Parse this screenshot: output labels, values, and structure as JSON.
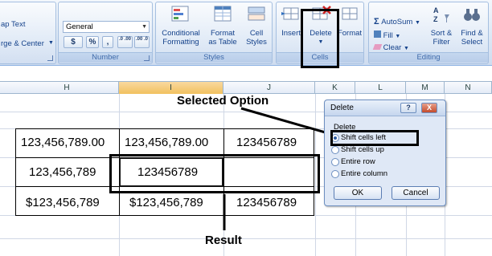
{
  "ribbon": {
    "alignment": {
      "wrap_text": "ap Text",
      "merge_center": "rge & Center"
    },
    "number": {
      "format_value": "General",
      "currency_symbol": "$",
      "percent_symbol": "%",
      "comma_symbol": ",",
      "increase_decimal": ".0 .00",
      "decrease_decimal": ".00 .0",
      "group_label": "Number"
    },
    "styles": {
      "conditional_formatting": [
        "Conditional",
        "Formatting"
      ],
      "format_as_table": [
        "Format",
        "as Table"
      ],
      "cell_styles": [
        "Cell",
        "Styles"
      ],
      "group_label": "Styles"
    },
    "cells": {
      "insert": "Insert",
      "delete": "Delete",
      "format": "Format",
      "group_label": "Cells"
    },
    "editing": {
      "autosum": "AutoSum",
      "fill": "Fill",
      "clear": "Clear",
      "sort_filter": [
        "Sort &",
        "Filter"
      ],
      "find_select": [
        "Find &",
        "Select"
      ],
      "group_label": "Editing"
    }
  },
  "columns": [
    "H",
    "I",
    "J",
    "K",
    "L",
    "M",
    "N"
  ],
  "selected_column": "I",
  "table": {
    "rows": [
      [
        "123,456,789.00",
        "123,456,789.00",
        "123456789"
      ],
      [
        "123,456,789",
        "123456789",
        ""
      ],
      [
        "$123,456,789",
        "$123,456,789",
        "123456789"
      ]
    ]
  },
  "annotations": {
    "selected_option": "Selected Option",
    "result": "Result"
  },
  "dialog": {
    "title": "Delete",
    "help": "?",
    "close": "X",
    "group_label": "Delete",
    "options": [
      "Shift cells left",
      "Shift cells up",
      "Entire row",
      "Entire column"
    ],
    "selected_option": 0,
    "ok": "OK",
    "cancel": "Cancel"
  },
  "colors": {
    "ribbon_text": "#15428b",
    "selected_header": "#f1c15f",
    "annotation": "#000000"
  }
}
